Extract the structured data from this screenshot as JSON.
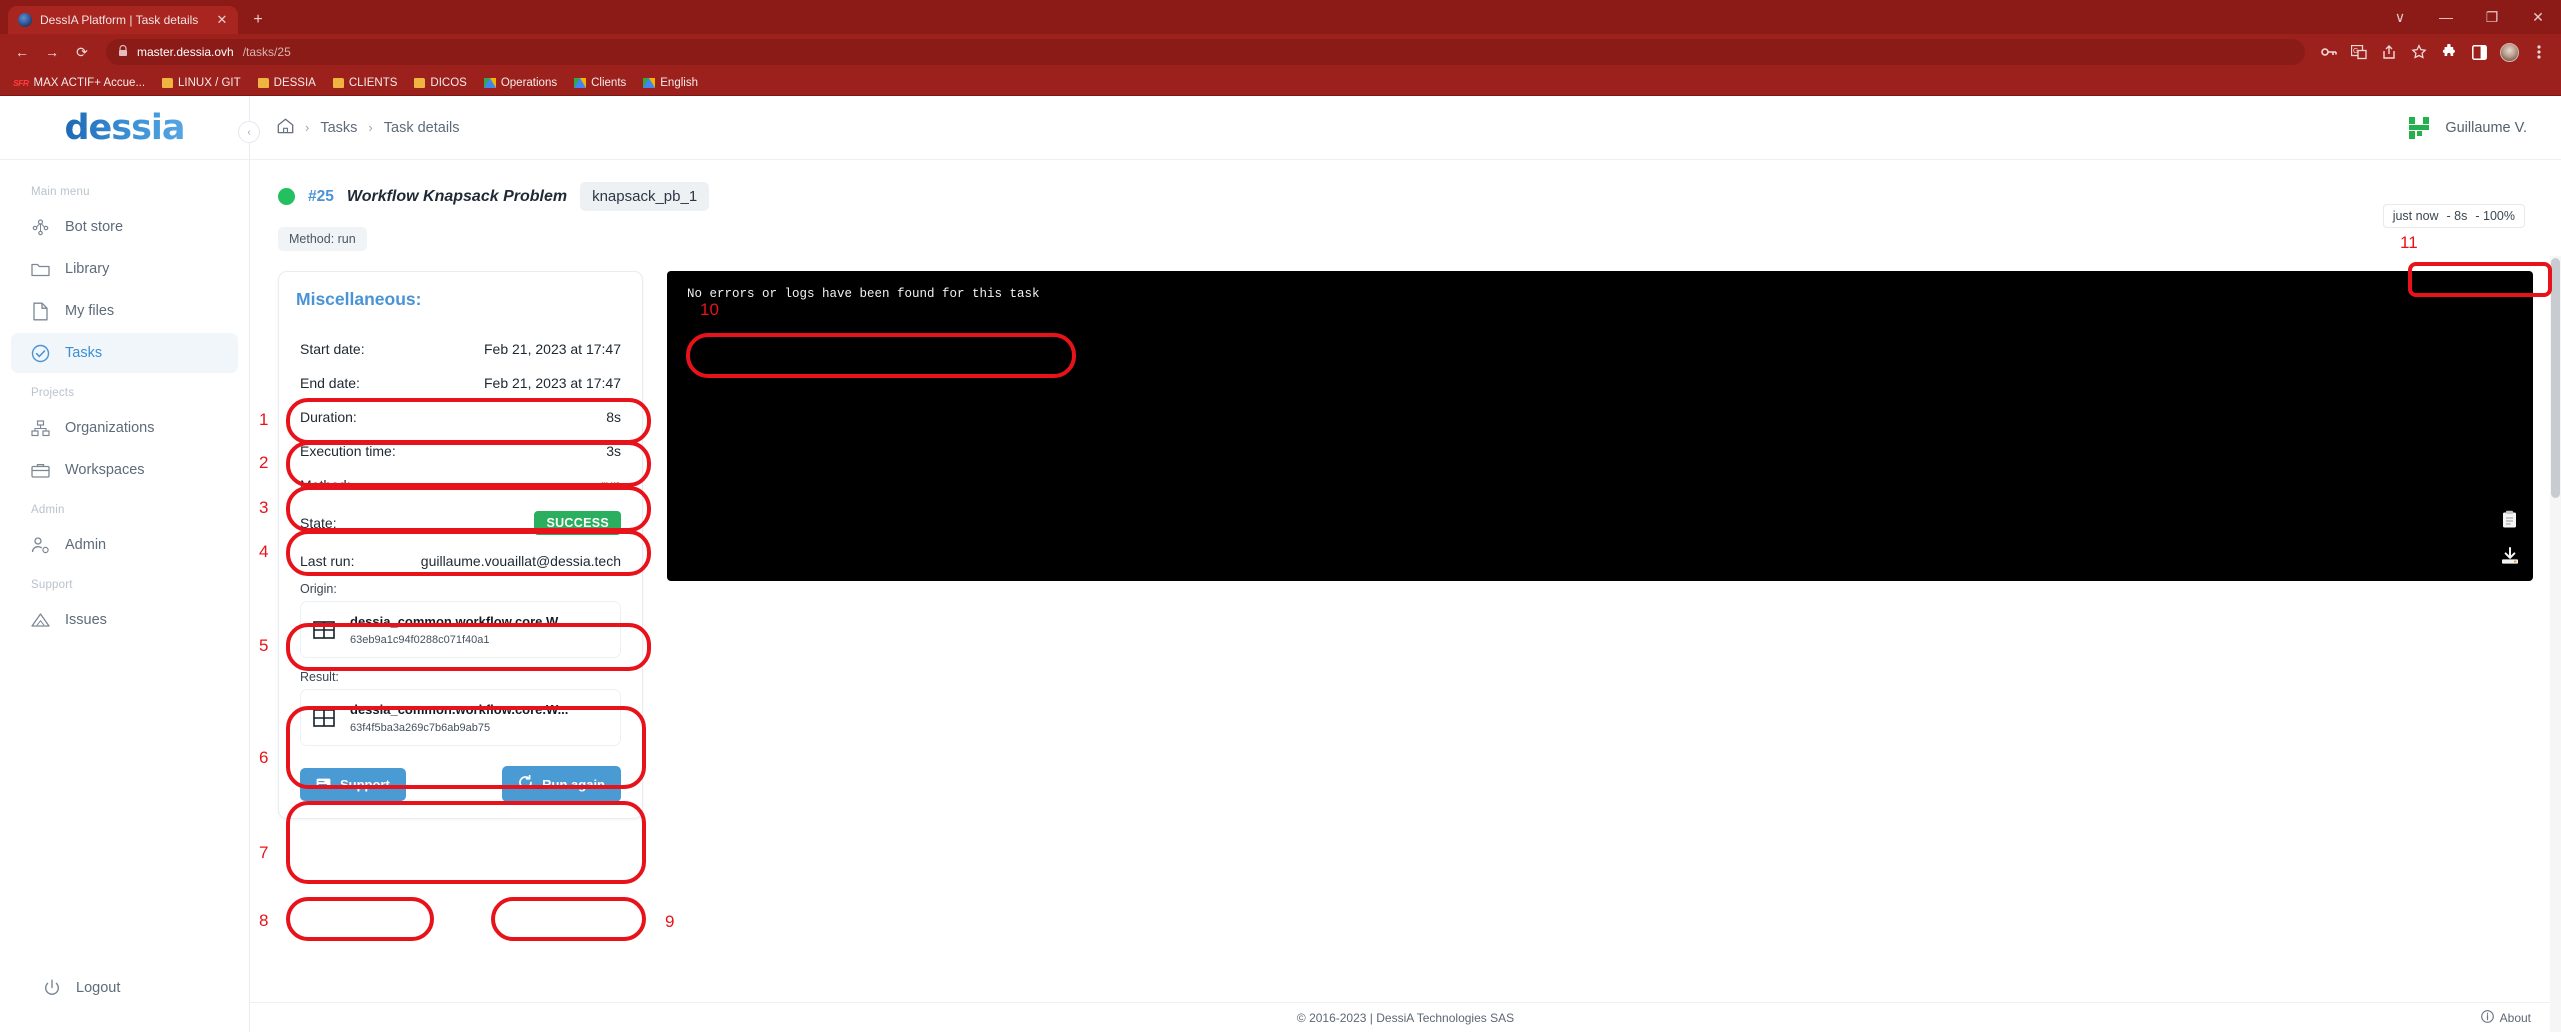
{
  "browser": {
    "tab": {
      "title": "DessIA Platform | Task details",
      "favicon": "dessia-favicon",
      "close": "✕"
    },
    "new_tab": "+",
    "window_controls": {
      "chevron": "∨",
      "minimize": "—",
      "restore": "❐",
      "close": "✕"
    },
    "nav": {
      "back": "←",
      "forward": "→",
      "reload": "⟳"
    },
    "omnibox": {
      "lock": "🔒",
      "host": "master.dessia.ovh",
      "path": "/tasks/25"
    },
    "toolbar_icons": [
      "key-icon",
      "translate-icon",
      "share-icon",
      "bookmark-star-icon",
      "extensions-puzzle-icon",
      "side-panel-icon",
      "profile-avatar",
      "chrome-menu-icon"
    ],
    "bookmarks": [
      {
        "label": "MAX ACTIF+ Accue...",
        "icon": "sfr-icon"
      },
      {
        "label": "LINUX / GIT",
        "icon": "folder-icon"
      },
      {
        "label": "DESSIA",
        "icon": "folder-icon"
      },
      {
        "label": "CLIENTS",
        "icon": "folder-icon"
      },
      {
        "label": "DICOS",
        "icon": "folder-icon"
      },
      {
        "label": "Operations",
        "icon": "drive-icon"
      },
      {
        "label": "Clients",
        "icon": "drive-icon"
      },
      {
        "label": "English",
        "icon": "drive-icon"
      }
    ]
  },
  "sidebar": {
    "logo": "dessia",
    "collapse": "‹",
    "sections": [
      {
        "label": "Main menu",
        "items": [
          {
            "label": "Bot store",
            "icon": "bot-store-icon",
            "active": false
          },
          {
            "label": "Library",
            "icon": "folder-icon",
            "active": false
          },
          {
            "label": "My files",
            "icon": "file-icon",
            "active": false
          },
          {
            "label": "Tasks",
            "icon": "check-circle-icon",
            "active": true
          }
        ]
      },
      {
        "label": "Projects",
        "items": [
          {
            "label": "Organizations",
            "icon": "org-chart-icon",
            "active": false
          },
          {
            "label": "Workspaces",
            "icon": "briefcase-icon",
            "active": false
          }
        ]
      },
      {
        "label": "Admin",
        "items": [
          {
            "label": "Admin",
            "icon": "user-gear-icon",
            "active": false
          }
        ]
      },
      {
        "label": "Support",
        "items": [
          {
            "label": "Issues",
            "icon": "warning-triangle-icon",
            "active": false
          }
        ]
      }
    ],
    "logout": {
      "label": "Logout",
      "icon": "power-icon"
    }
  },
  "topbar": {
    "breadcrumb": {
      "home_icon": "home-icon",
      "items": [
        "Tasks",
        "Task details"
      ],
      "separator": "›"
    },
    "user": {
      "name": "Guillaume V.",
      "avatar": "identicon-avatar",
      "avatar_color": "#22b14c"
    }
  },
  "task": {
    "status_dot_color": "#22c05e",
    "id": "#25",
    "name": "Workflow Knapsack Problem",
    "chip": "knapsack_pb_1",
    "method_chip": "Method: run",
    "time_badge": {
      "relative": "just now",
      "duration": "- 8s",
      "progress": "- 100%"
    }
  },
  "details_card": {
    "title": "Miscellaneous:",
    "rows": [
      {
        "key": "Start date:",
        "value": "Feb 21, 2023 at 17:47"
      },
      {
        "key": "End date:",
        "value": "Feb 21, 2023 at 17:47"
      },
      {
        "key": "Duration:",
        "value": "8s"
      },
      {
        "key": "Execution time:",
        "value": "3s"
      },
      {
        "key": "Method:",
        "value": "run"
      }
    ],
    "state": {
      "key": "State:",
      "value": "SUCCESS",
      "color": "#2bae5e"
    },
    "last_run": {
      "key": "Last run:",
      "value": "guillaume.vouaillat@dessia.tech"
    },
    "origin": {
      "label": "Origin:",
      "name": "dessia_common.workflow.core.W...",
      "id": "63eb9a1c94f0288c071f40a1",
      "icon": "grid-table-icon"
    },
    "result": {
      "label": "Result:",
      "name": "dessia_common.workflow.core.W...",
      "id": "63f4f5ba3a269c7b6ab9ab75",
      "icon": "grid-table-icon"
    },
    "support_button": {
      "label": "Support",
      "icon": "ticket-icon"
    },
    "run_again_button": {
      "label": "Run again",
      "icon": "refresh-icon"
    }
  },
  "log_panel": {
    "message": "No errors or logs have been found for this task",
    "copy_icon": "clipboard-copy-icon",
    "download_icon": "download-icon"
  },
  "footer": {
    "copyright": "© 2016-2023 | DessiA Technologies SAS",
    "about": {
      "label": "About",
      "icon": "info-icon"
    }
  },
  "annotations": {
    "color": "#e8131a",
    "numbers": [
      "1",
      "2",
      "3",
      "4",
      "5",
      "6",
      "7",
      "8",
      "9",
      "10",
      "11"
    ]
  }
}
